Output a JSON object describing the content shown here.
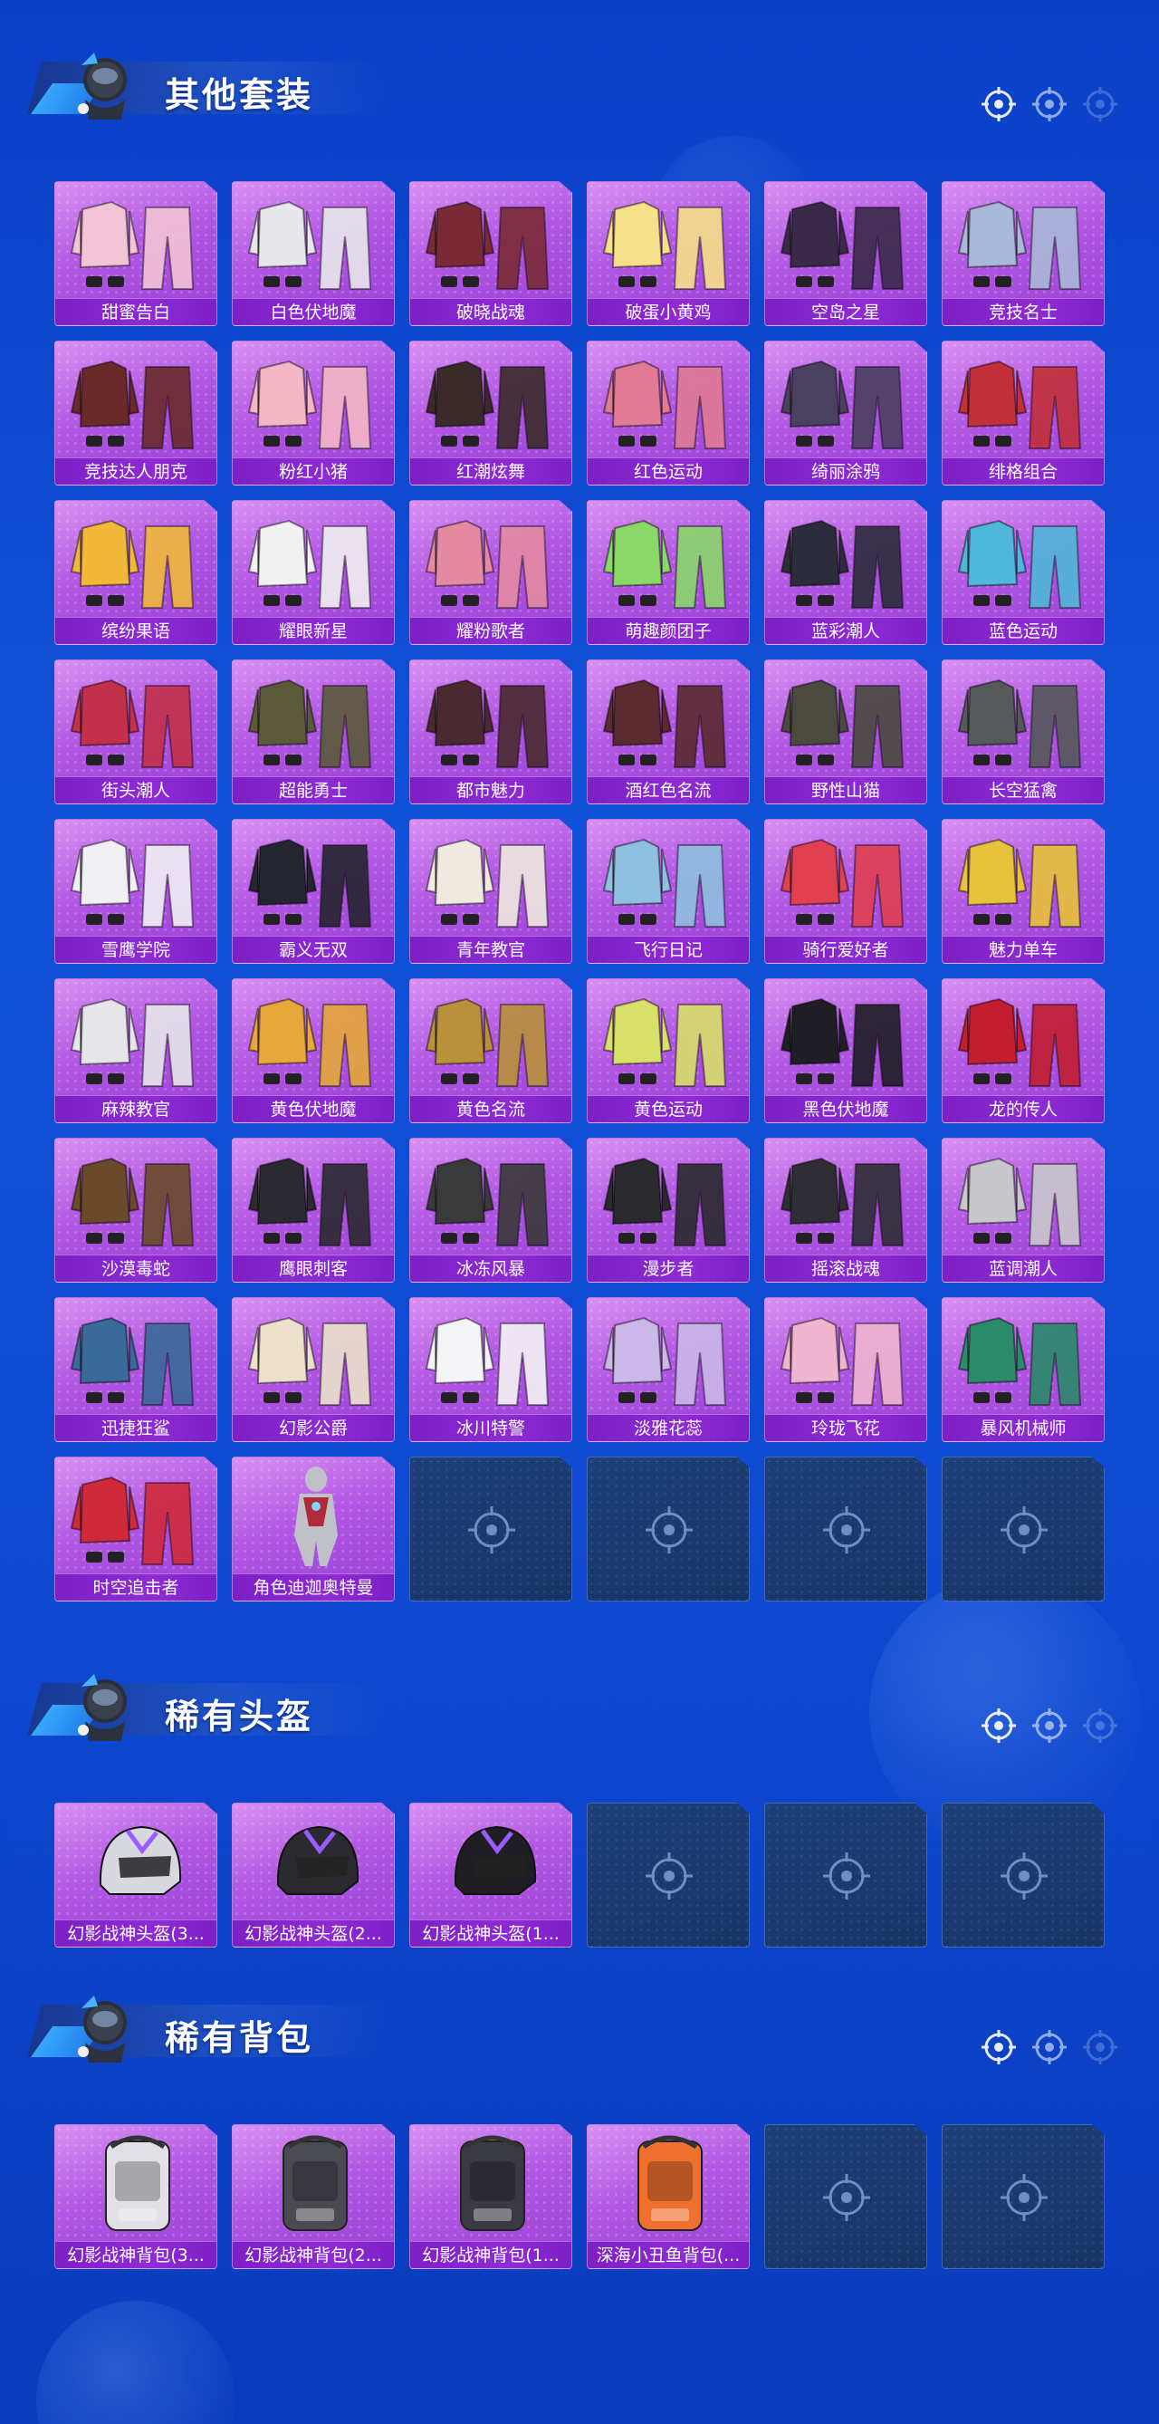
{
  "sections": [
    {
      "title": "其他套装",
      "items": [
        {
          "label": "甜蜜告白",
          "color": "#f3c4d6",
          "kind": "suit"
        },
        {
          "label": "白色伏地魔",
          "color": "#e8e8ec",
          "kind": "suit"
        },
        {
          "label": "破晓战魂",
          "color": "#7a2a36",
          "kind": "suit"
        },
        {
          "label": "破蛋小黄鸡",
          "color": "#f7e08a",
          "kind": "suit"
        },
        {
          "label": "空岛之星",
          "color": "#3a2a4a",
          "kind": "suit"
        },
        {
          "label": "竞技名士",
          "color": "#a9b9d9",
          "kind": "suit"
        },
        {
          "label": "竞技达人朋克",
          "color": "#6a2a2a",
          "kind": "suit"
        },
        {
          "label": "粉红小猪",
          "color": "#f5b7c6",
          "kind": "suit"
        },
        {
          "label": "红潮炫舞",
          "color": "#3b2a2a",
          "kind": "suit"
        },
        {
          "label": "红色运动",
          "color": "#e07a95",
          "kind": "suit"
        },
        {
          "label": "绮丽涂鸦",
          "color": "#4a4060",
          "kind": "suit"
        },
        {
          "label": "绯格组合",
          "color": "#c2303a",
          "kind": "suit"
        },
        {
          "label": "缤纷果语",
          "color": "#f2b83a",
          "kind": "suit"
        },
        {
          "label": "耀眼新星",
          "color": "#f1f1f1",
          "kind": "suit"
        },
        {
          "label": "耀粉歌者",
          "color": "#e58aa3",
          "kind": "suit"
        },
        {
          "label": "萌趣颜团子",
          "color": "#8bd86a",
          "kind": "suit"
        },
        {
          "label": "蓝彩潮人",
          "color": "#2c2c3a",
          "kind": "suit"
        },
        {
          "label": "蓝色运动",
          "color": "#4fb7d9",
          "kind": "suit"
        },
        {
          "label": "街头潮人",
          "color": "#c2304a",
          "kind": "suit"
        },
        {
          "label": "超能勇士",
          "color": "#5a5a3a",
          "kind": "suit"
        },
        {
          "label": "都市魅力",
          "color": "#4a2a30",
          "kind": "suit"
        },
        {
          "label": "酒红色名流",
          "color": "#5a2a30",
          "kind": "suit"
        },
        {
          "label": "野性山猫",
          "color": "#4a4a40",
          "kind": "suit"
        },
        {
          "label": "长空猛禽",
          "color": "#55595a",
          "kind": "suit"
        },
        {
          "label": "雪鹰学院",
          "color": "#f0f0f4",
          "kind": "suit"
        },
        {
          "label": "霸义无双",
          "color": "#252530",
          "kind": "suit"
        },
        {
          "label": "青年教官",
          "color": "#efe9e0",
          "kind": "suit"
        },
        {
          "label": "飞行日记",
          "color": "#8fc0e0",
          "kind": "suit"
        },
        {
          "label": "骑行爱好者",
          "color": "#e04050",
          "kind": "suit"
        },
        {
          "label": "魅力单车",
          "color": "#e8c23a",
          "kind": "suit"
        },
        {
          "label": "麻辣教官",
          "color": "#e6e6ea",
          "kind": "suit"
        },
        {
          "label": "黄色伏地魔",
          "color": "#e6a83a",
          "kind": "suit"
        },
        {
          "label": "黄色名流",
          "color": "#b8913a",
          "kind": "suit"
        },
        {
          "label": "黄色运动",
          "color": "#d9e06a",
          "kind": "suit"
        },
        {
          "label": "黑色伏地魔",
          "color": "#1e1e24",
          "kind": "suit"
        },
        {
          "label": "龙的传人",
          "color": "#c21e30",
          "kind": "suit"
        },
        {
          "label": "沙漠毒蛇",
          "color": "#6a4a2a",
          "kind": "suit"
        },
        {
          "label": "鹰眼刺客",
          "color": "#2a2a30",
          "kind": "suit"
        },
        {
          "label": "冰冻风暴",
          "color": "#3a3a3a",
          "kind": "suit"
        },
        {
          "label": "漫步者",
          "color": "#2a2a2e",
          "kind": "suit"
        },
        {
          "label": "摇滚战魂",
          "color": "#2e2e34",
          "kind": "suit"
        },
        {
          "label": "蓝调潮人",
          "color": "#c8c8cc",
          "kind": "suit"
        },
        {
          "label": "迅捷狂鲨",
          "color": "#3a6a9a",
          "kind": "suit"
        },
        {
          "label": "幻影公爵",
          "color": "#ece2cc",
          "kind": "suit"
        },
        {
          "label": "冰川特警",
          "color": "#f4f4f6",
          "kind": "suit"
        },
        {
          "label": "淡雅花蕊",
          "color": "#c9b8e8",
          "kind": "suit"
        },
        {
          "label": "玲珑飞花",
          "color": "#f0b6d0",
          "kind": "suit"
        },
        {
          "label": "暴风机械师",
          "color": "#2a8a6a",
          "kind": "suit"
        },
        {
          "label": "时空追击者",
          "color": "#d02a3a",
          "kind": "suit"
        },
        {
          "label": "角色迪迦奥特曼",
          "color": "#c0c0c8",
          "kind": "hero"
        },
        {
          "empty": true
        },
        {
          "empty": true
        },
        {
          "empty": true
        },
        {
          "empty": true
        }
      ]
    },
    {
      "title": "稀有头盔",
      "items": [
        {
          "label": "幻影战神头盔(3...",
          "color": "#d8d8e0",
          "kind": "helmet"
        },
        {
          "label": "幻影战神头盔(2...",
          "color": "#2a2a30",
          "kind": "helmet"
        },
        {
          "label": "幻影战神头盔(1...",
          "color": "#1e1e24",
          "kind": "helmet"
        },
        {
          "empty": true
        },
        {
          "empty": true
        },
        {
          "empty": true
        }
      ]
    },
    {
      "title": "稀有背包",
      "items": [
        {
          "label": "幻影战神背包(3...",
          "color": "#e0e0e6",
          "kind": "backpack"
        },
        {
          "label": "幻影战神背包(2...",
          "color": "#4a4a52",
          "kind": "backpack"
        },
        {
          "label": "幻影战神背包(1...",
          "color": "#3a3a42",
          "kind": "backpack"
        },
        {
          "label": "深海小丑鱼背包(...",
          "color": "#f07030",
          "kind": "backpack"
        },
        {
          "empty": true
        },
        {
          "empty": true
        }
      ]
    }
  ]
}
